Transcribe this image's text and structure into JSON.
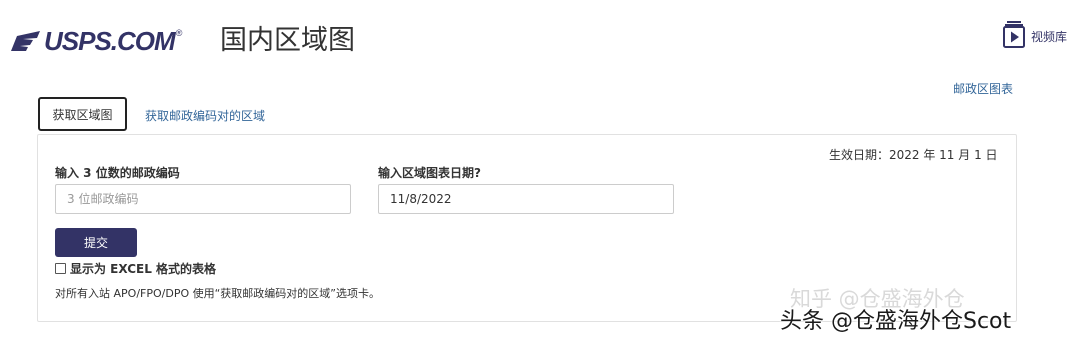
{
  "header": {
    "logo_text": "USPS.COM",
    "logo_trademark": "®",
    "title": "国内区域图",
    "video_label": "视频库"
  },
  "links": {
    "zone_chart": "邮政区图表"
  },
  "tabs": [
    {
      "label": "获取区域图",
      "active": true
    },
    {
      "label": "获取邮政编码对的区域",
      "active": false
    }
  ],
  "form": {
    "effective_date": "生效日期：2022 年 11 月 1 日",
    "zip_label": "输入 3 位数的邮政编码",
    "zip_placeholder": "3 位邮政编码",
    "zip_value": "",
    "date_label": "输入区域图表日期?",
    "date_value": "11/8/2022",
    "submit_label": "提交",
    "excel_label": "显示为 EXCEL 格式的表格",
    "excel_checked": false,
    "apo_note": "对所有入站 APO/FPO/DPO 使用“获取邮政编码对的区域”选项卡。"
  },
  "watermarks": {
    "zhihu": "知乎 @仓盛海外仓",
    "toutiao": "头条 @仓盛海外仓Scot"
  },
  "colors": {
    "brand_navy": "#333366",
    "link_blue": "#336699",
    "panel_border": "#e1e1e1"
  }
}
